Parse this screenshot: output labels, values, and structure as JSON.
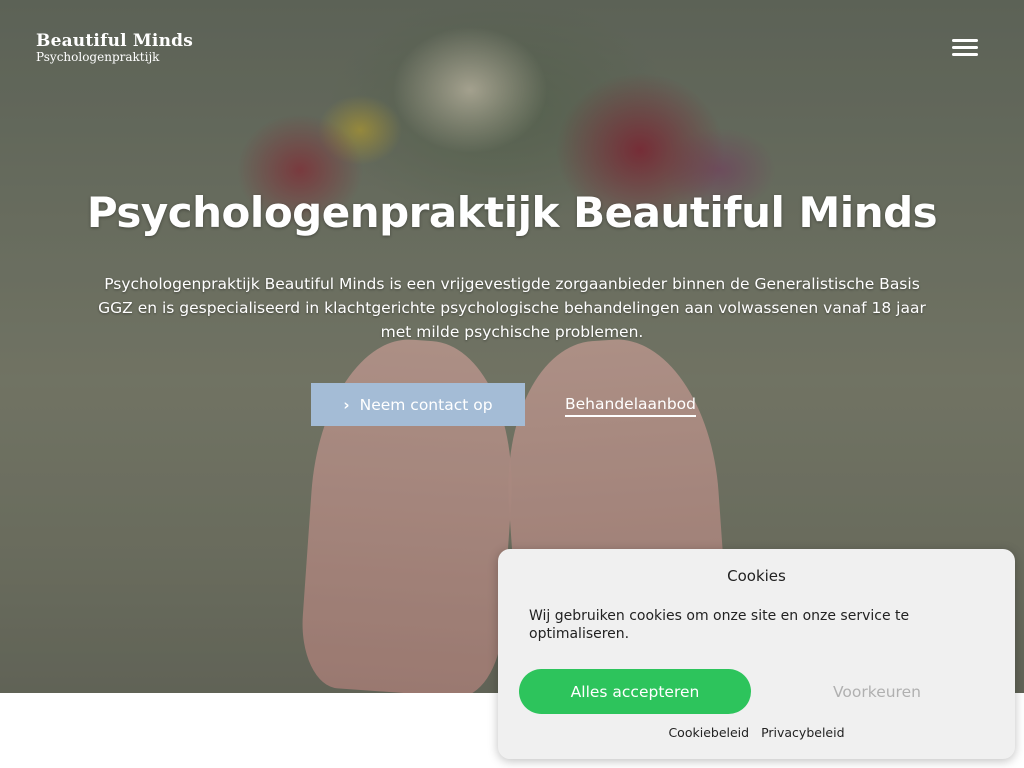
{
  "header": {
    "logo_title": "Beautiful Minds",
    "logo_subtitle": "Psychologenpraktijk",
    "menu_icon": "hamburger-menu-icon"
  },
  "hero": {
    "title": "Psychologenpraktijk Beautiful Minds",
    "text": "Psychologenpraktijk Beautiful Minds is een vrijgevestigde zorgaanbieder binnen de Generalistische Basis GGZ en is gespecialiseerd in klachtgerichte psychologische behandelingen aan volwassenen vanaf 18 jaar met milde psychische problemen.",
    "contact_button": "Neem contact op",
    "contact_icon": "chevron-right-icon",
    "treatment_link": "Behandelaanbod"
  },
  "cookie_banner": {
    "title": "Cookies",
    "message": "Wij gebruiken cookies om onze site en onze service te optimaliseren.",
    "accept_button": "Alles accepteren",
    "preferences_button": "Voorkeuren",
    "cookie_policy_link": "Cookiebeleid",
    "privacy_policy_link": "Privacybeleid"
  },
  "colors": {
    "contact_button_bg": "#a4bcd6",
    "accept_button_bg": "#2dc45c",
    "cookie_banner_bg": "#f0f0f0"
  }
}
